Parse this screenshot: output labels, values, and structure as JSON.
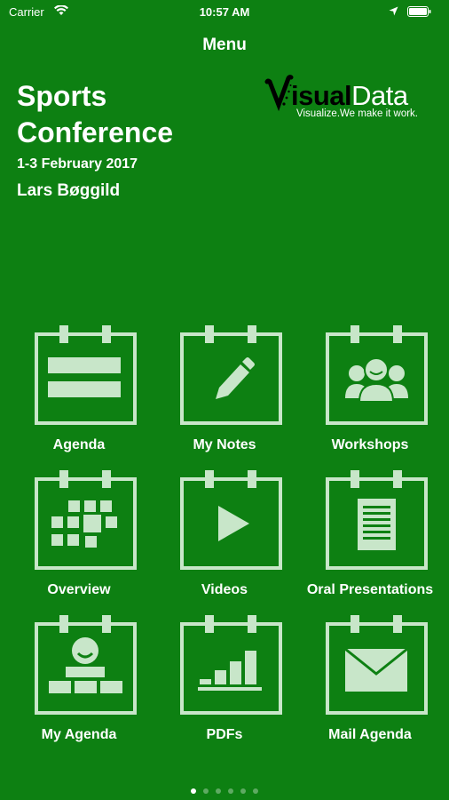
{
  "status_bar": {
    "carrier": "Carrier",
    "time": "10:57 AM"
  },
  "nav": {
    "title": "Menu"
  },
  "conference": {
    "title": "Sports Conference",
    "dates": "1-3 February 2017",
    "user": "Lars Bøggild"
  },
  "logo": {
    "word_bold": "isual",
    "word_thin": "Data",
    "tagline": "Visualize.We make it work."
  },
  "tiles": [
    {
      "label": "Agenda",
      "icon": "agenda-list-icon"
    },
    {
      "label": "My Notes",
      "icon": "pencil-icon"
    },
    {
      "label": "Workshops",
      "icon": "people-group-icon"
    },
    {
      "label": "Overview",
      "icon": "calendar-grid-icon"
    },
    {
      "label": "Videos",
      "icon": "play-icon"
    },
    {
      "label": "Oral Presentations",
      "icon": "document-icon"
    },
    {
      "label": "My Agenda",
      "icon": "person-icon"
    },
    {
      "label": "PDFs",
      "icon": "bar-chart-icon"
    },
    {
      "label": "Mail Agenda",
      "icon": "envelope-icon"
    }
  ],
  "pagination": {
    "count": 6,
    "active": 1
  },
  "colors": {
    "background": "#0d8012",
    "icon": "#c8e6c9"
  }
}
